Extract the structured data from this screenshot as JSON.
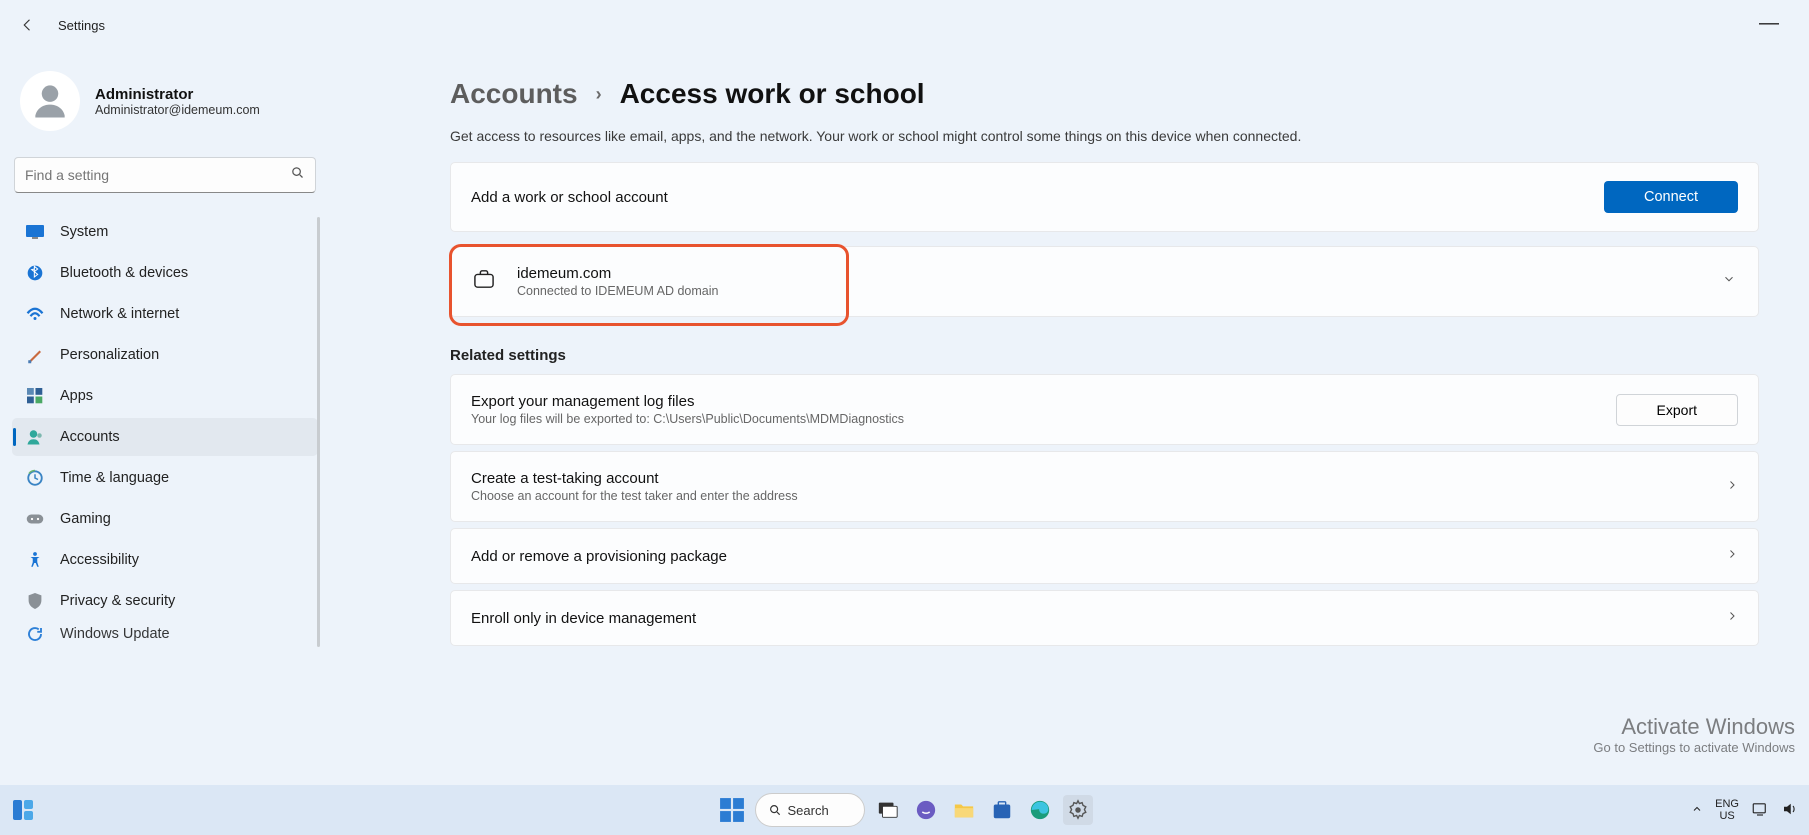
{
  "window": {
    "title": "Settings"
  },
  "profile": {
    "name": "Administrator",
    "email": "Administrator@idemeum.com"
  },
  "search": {
    "placeholder": "Find a setting"
  },
  "nav": {
    "items": [
      {
        "label": "System"
      },
      {
        "label": "Bluetooth & devices"
      },
      {
        "label": "Network & internet"
      },
      {
        "label": "Personalization"
      },
      {
        "label": "Apps"
      },
      {
        "label": "Accounts"
      },
      {
        "label": "Time & language"
      },
      {
        "label": "Gaming"
      },
      {
        "label": "Accessibility"
      },
      {
        "label": "Privacy & security"
      },
      {
        "label": "Windows Update"
      }
    ]
  },
  "breadcrumb": {
    "parent": "Accounts",
    "current": "Access work or school"
  },
  "description": "Get access to resources like email, apps, and the network. Your work or school might control some things on this device when connected.",
  "addAccount": {
    "label": "Add a work or school account",
    "button": "Connect"
  },
  "domainAccount": {
    "name": "idemeum.com",
    "status": "Connected to IDEMEUM AD domain"
  },
  "related": {
    "title": "Related settings",
    "export": {
      "title": "Export your management log files",
      "sub": "Your log files will be exported to: C:\\Users\\Public\\Documents\\MDMDiagnostics",
      "button": "Export"
    },
    "testTaking": {
      "title": "Create a test-taking account",
      "sub": "Choose an account for the test taker and enter the address"
    },
    "provisioning": {
      "title": "Add or remove a provisioning package"
    },
    "enroll": {
      "title": "Enroll only in device management"
    }
  },
  "watermark": {
    "line1": "Activate Windows",
    "line2": "Go to Settings to activate Windows"
  },
  "taskbar": {
    "search": "Search",
    "lang1": "ENG",
    "lang2": "US"
  }
}
